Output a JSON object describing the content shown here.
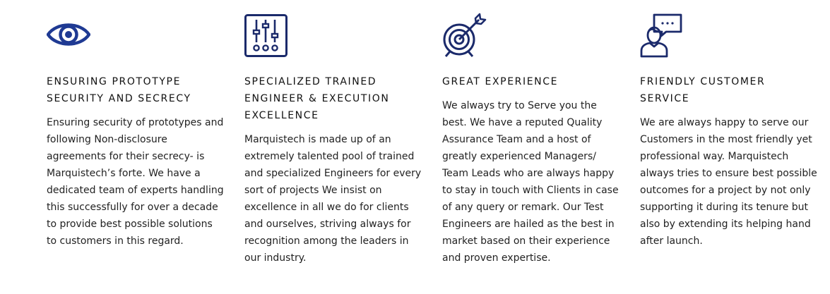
{
  "brand": {
    "icon_color": "#1b2a6b",
    "eye_color": "#1f3a93"
  },
  "features": [
    {
      "icon": "eye-icon",
      "title": "ENSURING PROTOTYPE\nSECURITY AND SECRECY",
      "text": "Ensuring security of prototypes and following Non-disclosure agreements for their secrecy- is Marquistech’s forte. We have a dedicated team of experts handling this successfully for over a decade to provide best possible solutions to customers in this regard."
    },
    {
      "icon": "equalizer-sliders-icon",
      "title": "SPECIALIZED TRAINED\nENGINEER & EXECUTION\nEXCELLENCE",
      "text": "Marquistech is made up of an extremely talented pool of trained and specialized Engineers for every sort of projects We insist on excellence in all we do for clients and ourselves, striving always for recognition among the leaders in our industry."
    },
    {
      "icon": "target-arrow-icon",
      "title": "GREAT EXPERIENCE",
      "text": "We always try to Serve you the best. We have a reputed Quality Assurance Team and a host of greatly experienced Managers/ Team Leads who are always happy to stay in touch with Clients in case of any query or remark. Our Test Engineers are hailed as the best in market based on their experience and proven expertise."
    },
    {
      "icon": "customer-service-chat-icon",
      "title": "FRIENDLY CUSTOMER\nSERVICE",
      "text": "We are always happy to serve our Customers in the most friendly yet professional way. Marquistech always tries to ensure best possible outcomes for a project by not only supporting it during its tenure but also by extending its helping hand after launch."
    }
  ]
}
